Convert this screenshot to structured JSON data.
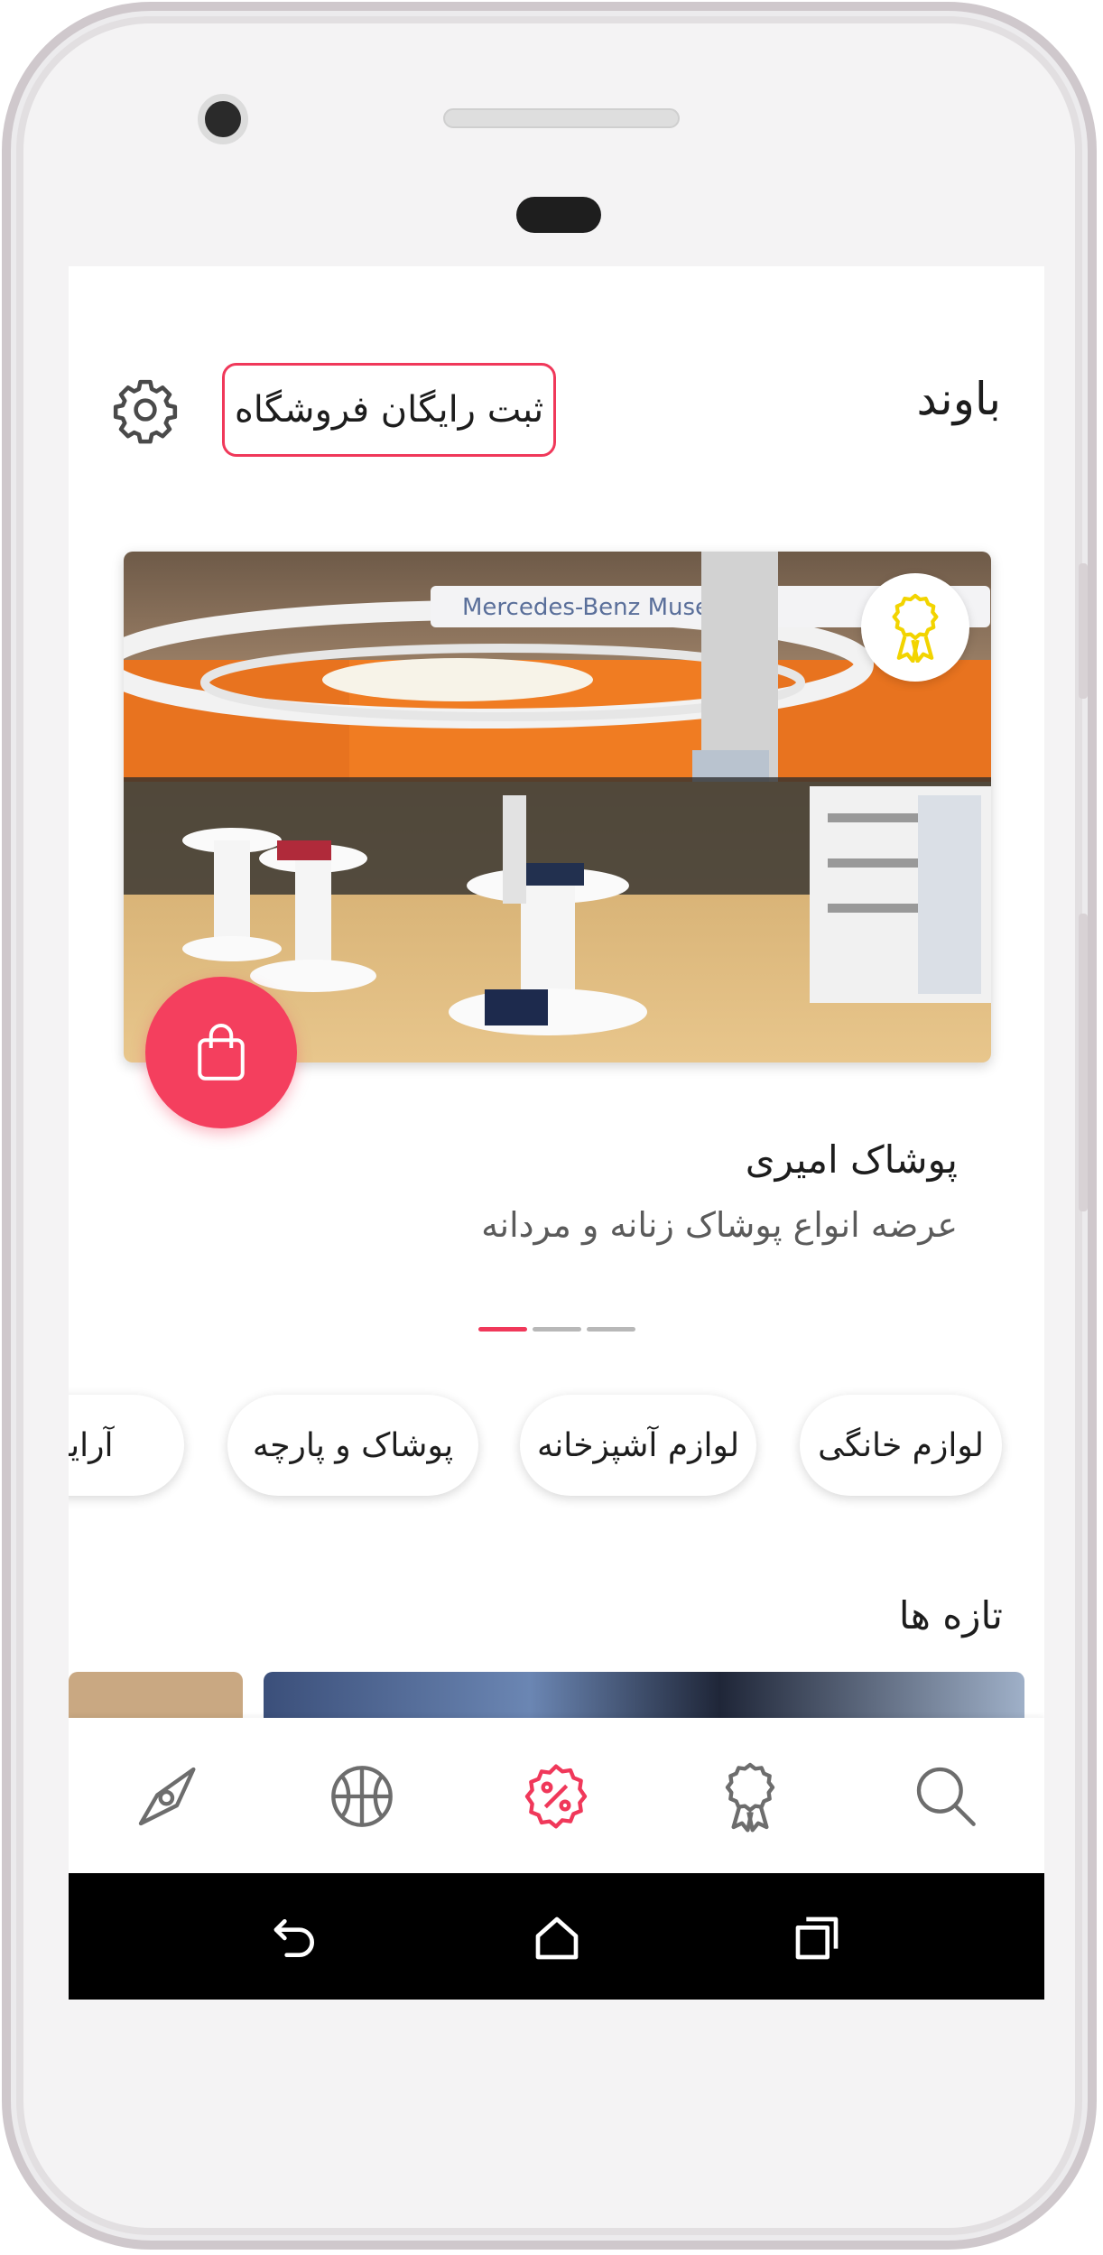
{
  "header": {
    "app_title": "باوند",
    "register_label": "ثبت رایگان فروشگاه"
  },
  "featured_store": {
    "name": "پوشاک امیری",
    "description": "عرضه انواع پوشاک زنانه و مردانه",
    "image_sign_text": "Mercedes-Benz Museum",
    "carousel_active_index": 0,
    "carousel_count": 3
  },
  "categories": [
    {
      "label": "لوازم خانگی"
    },
    {
      "label": "لوازم آشپزخانه"
    },
    {
      "label": "پوشاک و پارچه"
    },
    {
      "label": "آرایشی"
    }
  ],
  "new_section": {
    "title": "تازه ها"
  },
  "bottom_nav": {
    "items": [
      {
        "icon": "compass-icon"
      },
      {
        "icon": "basketball-icon"
      },
      {
        "icon": "discount-icon",
        "active": true
      },
      {
        "icon": "award-ribbon-icon"
      },
      {
        "icon": "search-icon"
      }
    ]
  },
  "colors": {
    "accent": "#f0385a",
    "badge_icon": "#f2d400",
    "nav_inactive": "#6d6d6d"
  }
}
